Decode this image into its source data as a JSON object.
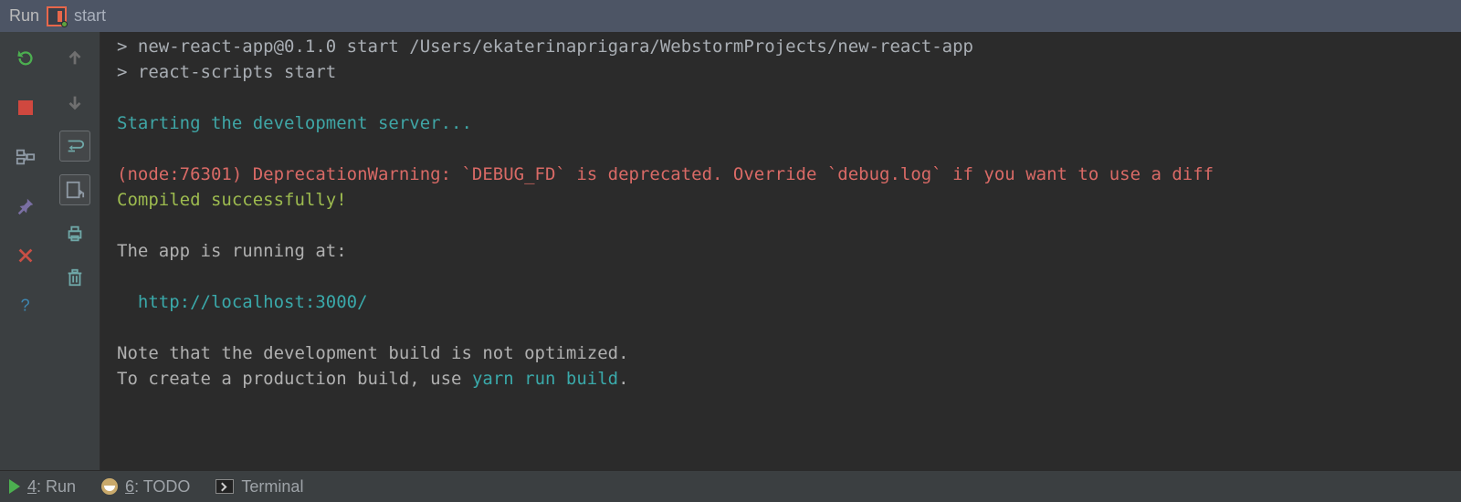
{
  "title": {
    "tool": "Run",
    "config": "start"
  },
  "console": {
    "line0": "> new-react-app@0.1.0 start /Users/ekaterinaprigara/WebstormProjects/new-react-app",
    "line1": "> react-scripts start",
    "line2": "Starting the development server...",
    "line3": "(node:76301) DeprecationWarning: `DEBUG_FD` is deprecated. Override `debug.log` if you want to use a diff",
    "line4": "Compiled successfully!",
    "line5": "The app is running at:",
    "line6": "  http://localhost:3000/",
    "line7": "Note that the development build is not optimized.",
    "line8a": "To create a production build, use ",
    "line8b": "yarn run build",
    "line8c": "."
  },
  "bottom": {
    "run_n": "4",
    "run_label": ": Run",
    "todo_n": "6",
    "todo_label": ": TODO",
    "terminal": "Terminal"
  }
}
